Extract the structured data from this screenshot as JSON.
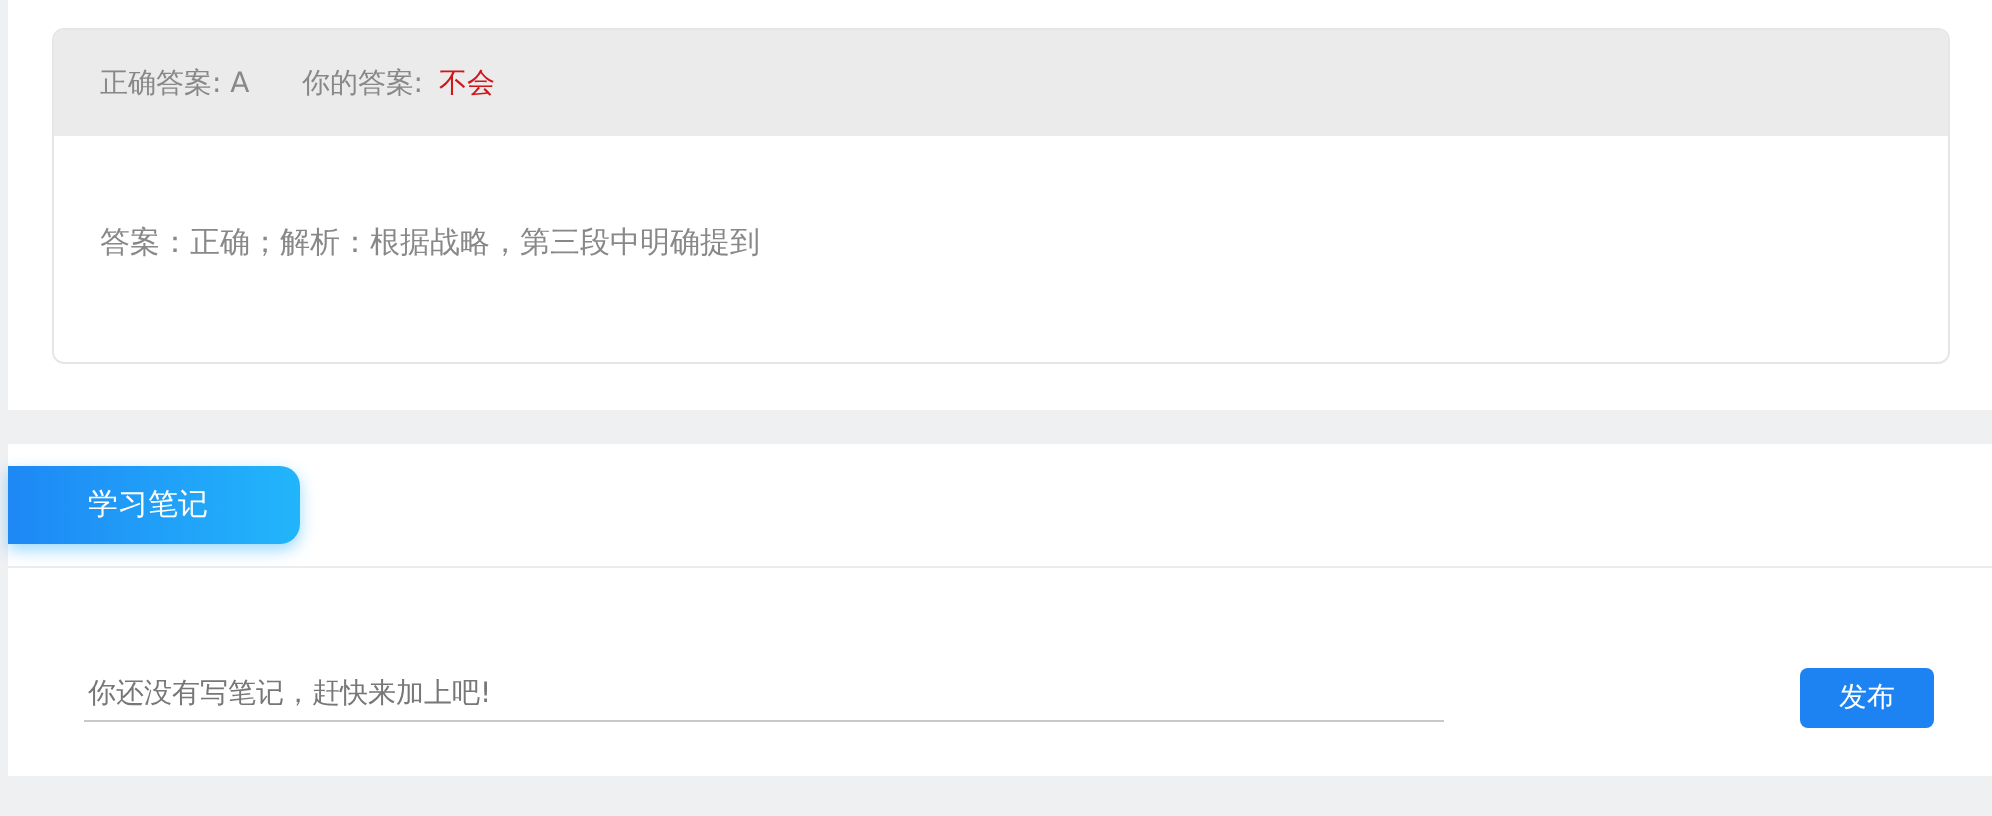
{
  "answer_card": {
    "correct_answer": "正确答案: A",
    "your_answer_label": "你的答案:",
    "your_answer": "不会",
    "your_answer_correct": false,
    "explanation": "答案：正确；解析：根据战略，第三段中明确提到"
  },
  "notes": {
    "tab": "学习笔记",
    "placeholder": "你还没有写笔记，赶快来加上吧!",
    "button": "发布"
  }
}
